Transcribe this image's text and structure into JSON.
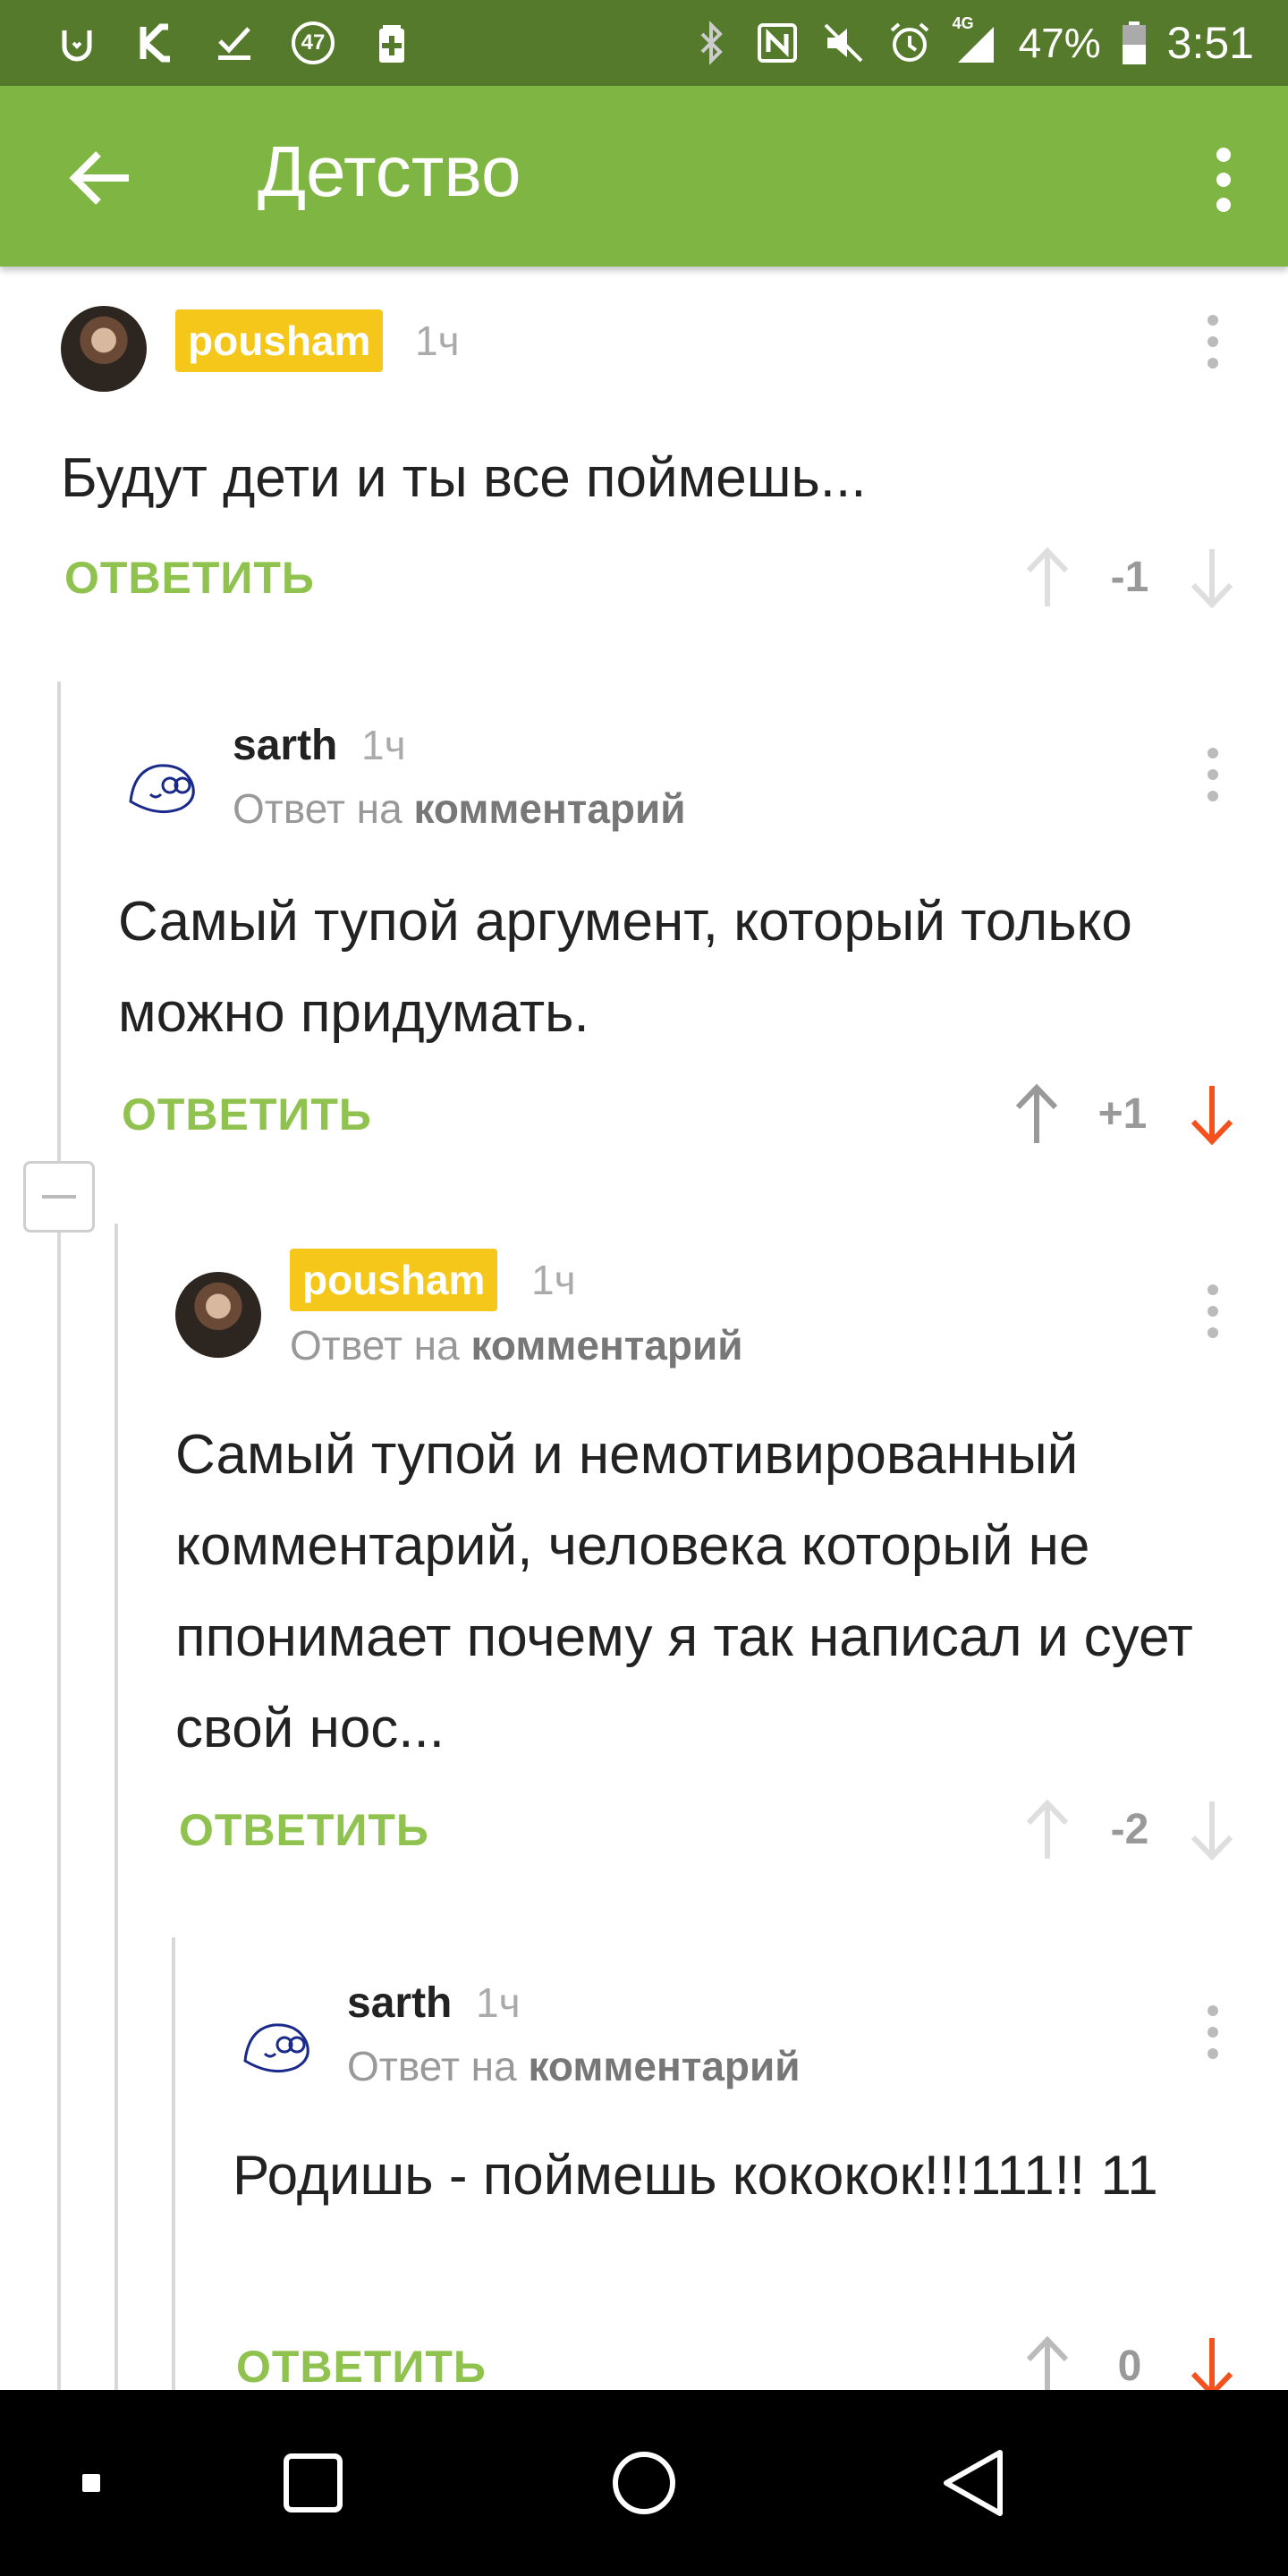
{
  "status_bar": {
    "badge_count": "47",
    "network": "4G",
    "battery": "47%",
    "time": "3:51"
  },
  "app_bar": {
    "title": "Детство"
  },
  "comments": [
    {
      "author": "pousham",
      "time": "1ч",
      "reply_to_prefix": "",
      "reply_to_target": "",
      "text": "Будут дети и ты все поймешь...",
      "reply_label": "ОТВЕТИТЬ",
      "score": "-1"
    },
    {
      "author": "sarth",
      "time": "1ч",
      "reply_to_prefix": "Ответ на",
      "reply_to_target": "комментарий",
      "text": "Самый тупой аргумент, который только можно придумать.",
      "reply_label": "ОТВЕТИТЬ",
      "score": "+1"
    },
    {
      "author": "pousham",
      "time": "1ч",
      "reply_to_prefix": "Ответ на",
      "reply_to_target": "комментарий",
      "text": "Самый тупой и немотивированный комментарий, человека который не ппонимает почему я так написал и сует свой нос...",
      "reply_label": "ОТВЕТИТЬ",
      "score": "-2"
    },
    {
      "author": "sarth",
      "time": "1ч",
      "reply_to_prefix": "Ответ на",
      "reply_to_target": "комментарий",
      "text": "Родишь - поймешь кококок!!!111!! 11",
      "reply_label": "ОТВЕТИТЬ",
      "score": "0"
    }
  ],
  "colors": {
    "status_bar": "#557a2c",
    "app_bar": "#7fb543",
    "accent_green": "#8fc24e",
    "author_badge": "#f5c71a",
    "downvote_active": "#f4511e",
    "upvote_active": "#999999"
  }
}
